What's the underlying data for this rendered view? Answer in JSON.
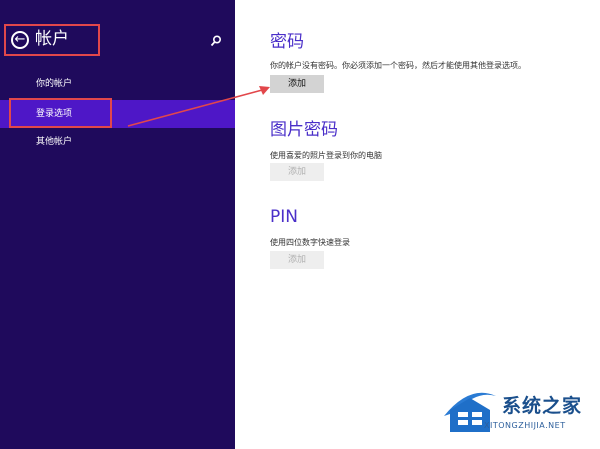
{
  "sidebar": {
    "title": "帐户",
    "items": [
      {
        "label": "你的帐户"
      },
      {
        "label": "登录选项"
      },
      {
        "label": "其他帐户"
      }
    ]
  },
  "main": {
    "sections": [
      {
        "title": "密码",
        "description": "你的帐户没有密码。你必须添加一个密码，然后才能使用其他登录选项。",
        "button": "添加",
        "enabled": true
      },
      {
        "title": "图片密码",
        "description": "使用喜爱的照片登录到你的电脑",
        "button": "添加",
        "enabled": false
      },
      {
        "title": "PIN",
        "description": "使用四位数字快速登录",
        "button": "添加",
        "enabled": false
      }
    ]
  },
  "watermark": {
    "brand": "系统之家",
    "url": "XITONGZHIJIA.NET"
  },
  "colors": {
    "sidebar_bg": "#1f0a5c",
    "selected_bg": "#4e17c7",
    "accent_title": "#4a2fc9",
    "annotation_red": "#e2474b"
  },
  "icons": {
    "back": "back-arrow-circle-icon",
    "search": "search-icon"
  }
}
